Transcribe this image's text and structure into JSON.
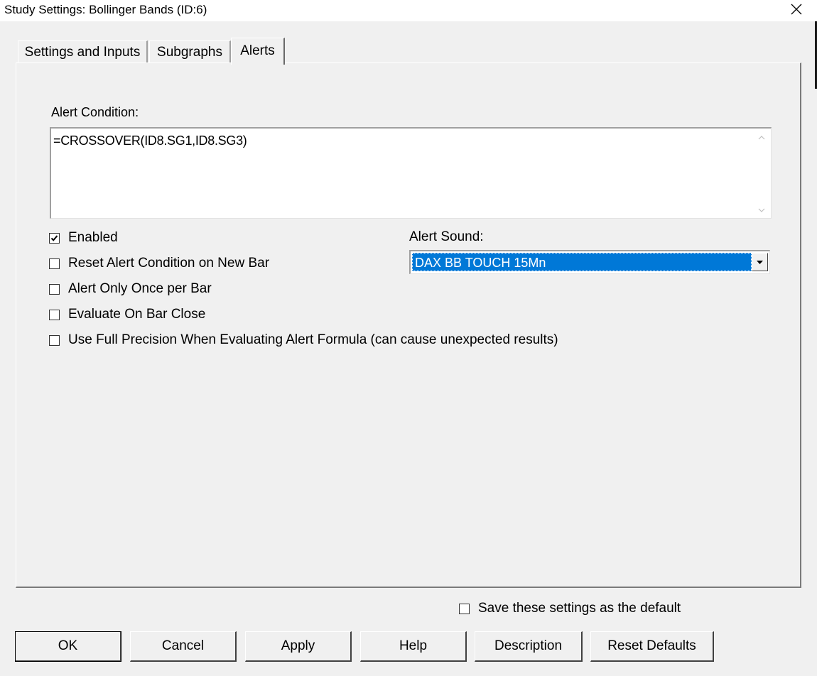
{
  "window": {
    "title": "Study Settings: Bollinger Bands (ID:6)",
    "close_icon": "close-icon"
  },
  "tabs": [
    {
      "label": "Settings and Inputs",
      "active": false
    },
    {
      "label": "Subgraphs",
      "active": false
    },
    {
      "label": "Alerts",
      "active": true
    }
  ],
  "alerts": {
    "condition_label": "Alert Condition:",
    "condition_value": "=CROSSOVER(ID8.SG1,ID8.SG3)",
    "options": [
      {
        "label": "Enabled",
        "checked": true
      },
      {
        "label": "Reset Alert Condition on New Bar",
        "checked": false
      },
      {
        "label": "Alert Only Once per Bar",
        "checked": false
      },
      {
        "label": "Evaluate On Bar Close",
        "checked": false
      },
      {
        "label": "Use Full Precision When Evaluating Alert Formula (can cause unexpected results)",
        "checked": false
      }
    ],
    "sound_label": "Alert Sound:",
    "sound_value": "DAX BB TOUCH 15Mn"
  },
  "footer": {
    "save_default_label": "Save these settings as the default",
    "save_default_checked": false,
    "buttons": {
      "ok": "OK",
      "cancel": "Cancel",
      "apply": "Apply",
      "help": "Help",
      "description": "Description",
      "reset_defaults": "Reset Defaults"
    }
  }
}
